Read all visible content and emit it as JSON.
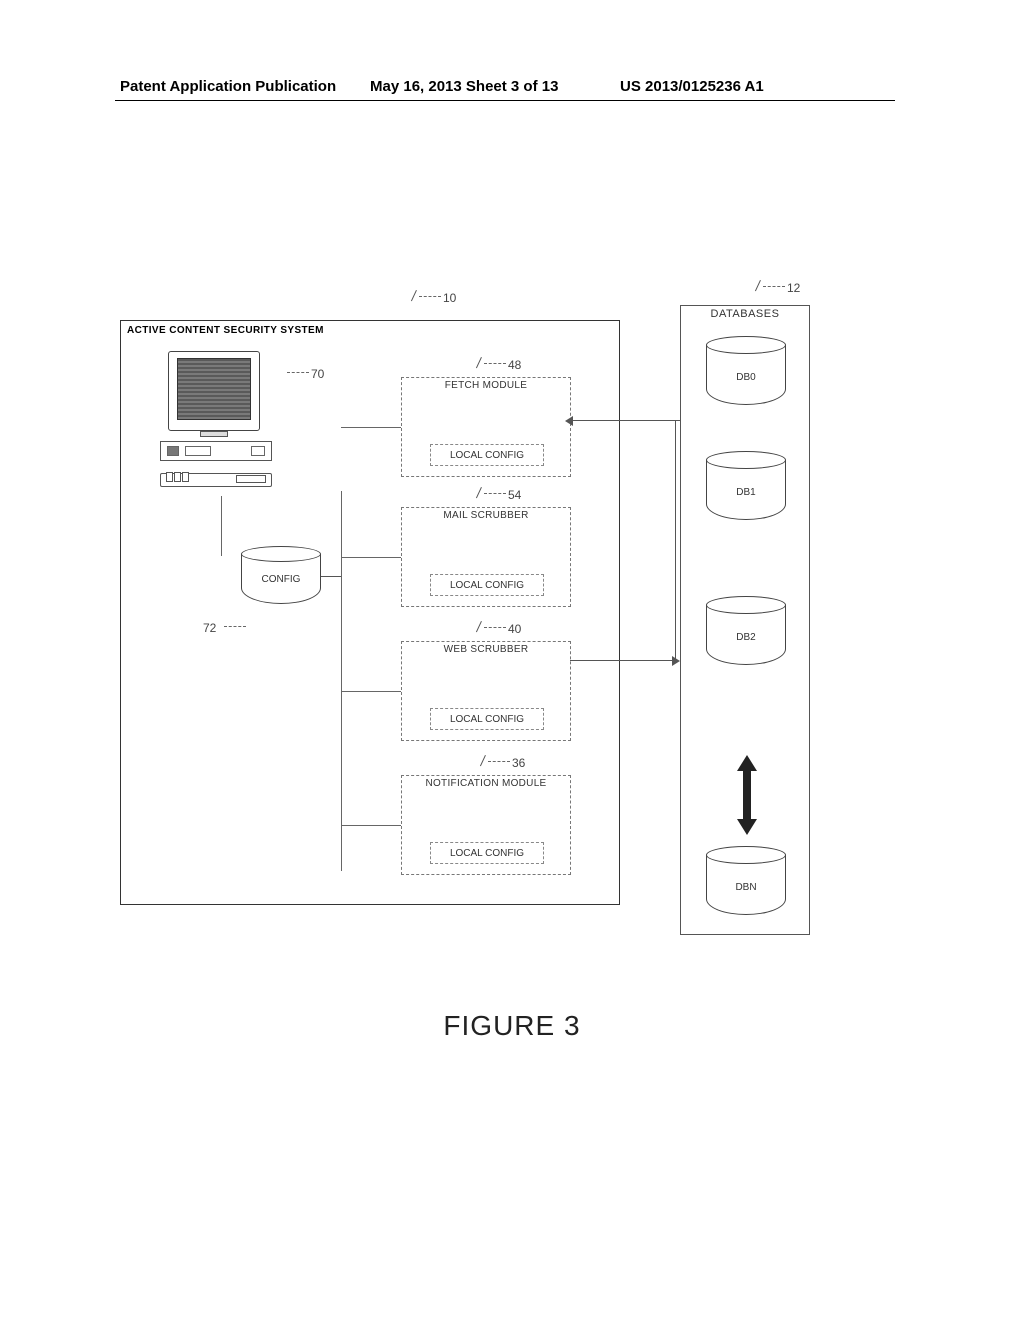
{
  "header": {
    "pub_type": "Patent Application Publication",
    "date_sheet": "May 16, 2013  Sheet 3 of 13",
    "pub_number": "US 2013/0125236 A1"
  },
  "system": {
    "title": "ACTIVE CONTENT SECURITY SYSTEM",
    "ref": "10",
    "computer_ref": "70",
    "config_label": "CONFIG",
    "config_ref": "72",
    "modules": [
      {
        "ref": "48",
        "title": "FETCH MODULE",
        "local": "LOCAL CONFIG"
      },
      {
        "ref": "54",
        "title": "MAIL SCRUBBER",
        "local": "LOCAL CONFIG"
      },
      {
        "ref": "40",
        "title": "WEB SCRUBBER",
        "local": "LOCAL CONFIG"
      },
      {
        "ref": "36",
        "title": "NOTIFICATION MODULE",
        "local": "LOCAL CONFIG"
      }
    ]
  },
  "databases": {
    "title": "DATABASES",
    "ref": "12",
    "items": [
      "DB0",
      "DB1",
      "DB2",
      "DBN"
    ]
  },
  "caption": "FIGURE 3"
}
